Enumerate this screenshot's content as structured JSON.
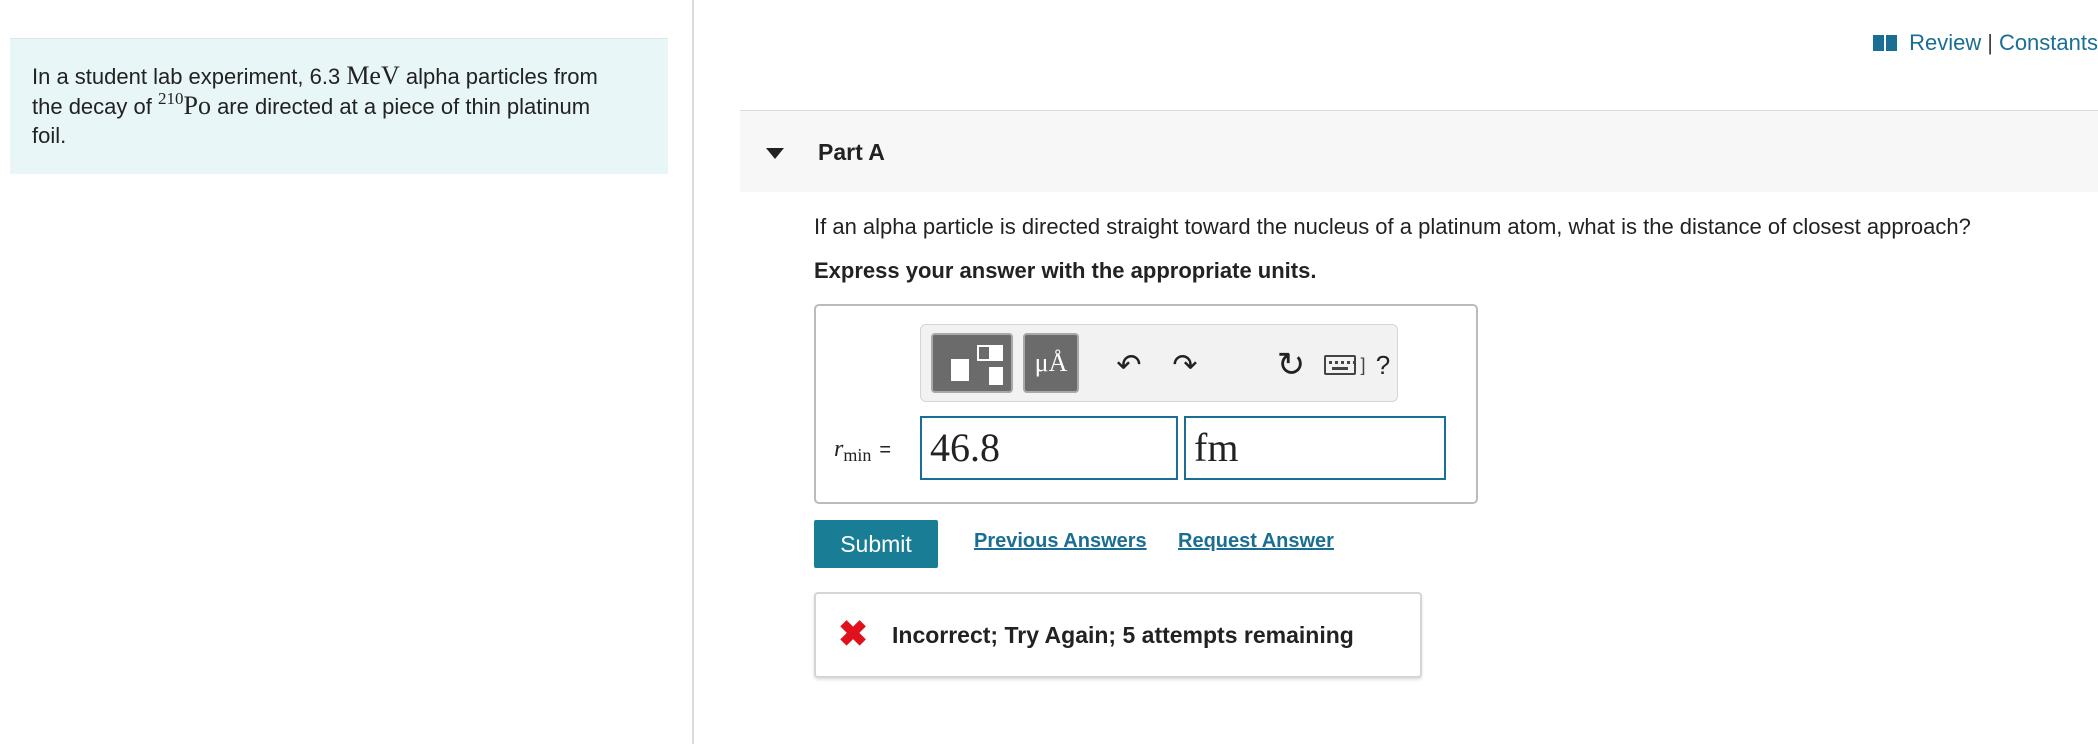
{
  "intro": {
    "line1_a": "In a student lab experiment, 6.3 ",
    "line1_unit": "MeV",
    "line1_b": " alpha particles from",
    "line2_a": "the decay of ",
    "line2_sup": "210",
    "line2_elem": "Po",
    "line2_b": " are directed at a piece of thin platinum",
    "line3": "foil."
  },
  "header": {
    "review": "Review",
    "separator": "|",
    "constants": "Constants"
  },
  "part": {
    "title": "Part A",
    "question": "If an alpha particle is directed straight toward the nucleus of a platinum atom, what is the distance of closest approach?",
    "instruction": "Express your answer with the appropriate units."
  },
  "toolbar": {
    "units_label": "μÅ",
    "undo_symbol": "↶",
    "redo_symbol": "↷",
    "reset_symbol": "↻",
    "keyboard_bracket": "]",
    "help_symbol": "?"
  },
  "answer": {
    "variable": "r",
    "subscript": "min",
    "equals": "=",
    "value": "46.8",
    "unit": "fm"
  },
  "actions": {
    "submit": "Submit",
    "previous_answers": "Previous Answers",
    "request_answer": "Request Answer"
  },
  "feedback": {
    "icon": "✖",
    "message": "Incorrect; Try Again; 5 attempts remaining"
  },
  "colors": {
    "accent": "#1a7d96",
    "link": "#1a6e93",
    "error": "#e0101d",
    "intro_bg": "#e8f6f7"
  }
}
